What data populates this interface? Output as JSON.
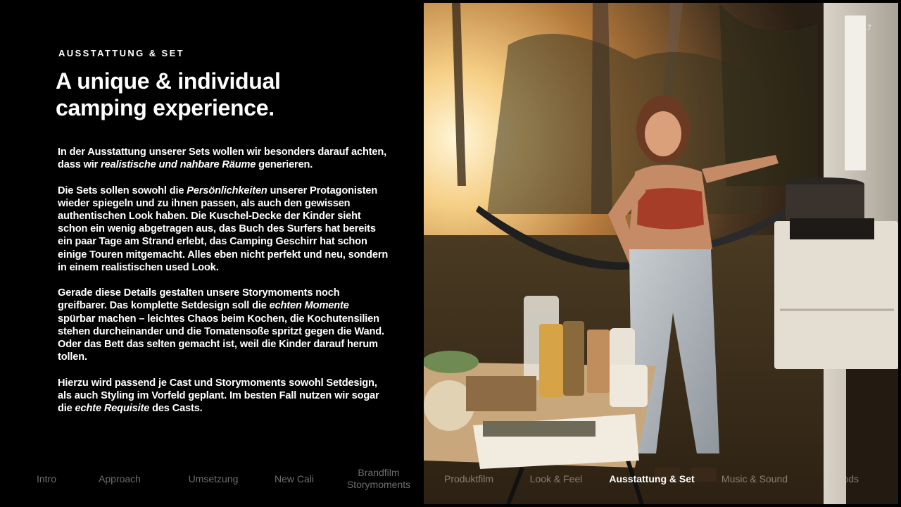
{
  "section": {
    "eyebrow": "AUSSTATTUNG & SET",
    "headline_line1": "A unique & individual",
    "headline_line2": "camping experience."
  },
  "body": {
    "p1": [
      "In der Ausstattung unserer Sets wollen wir besonders darauf achten, dass wir ",
      "realistische und nahbare Räume",
      " generieren."
    ],
    "p2": [
      "Die Sets sollen sowohl die ",
      "Persönlichkeiten",
      " unserer Protagonisten wieder spiegeln und zu ihnen passen, als auch den gewissen authentischen Look haben. Die Kuschel-Decke der Kinder sieht schon ein wenig abgetragen aus, das Buch des Surfers hat bereits ein paar Tage am Strand erlebt, das Camping Geschirr hat schon einige Touren mitgemacht. Alles eben nicht perfekt und neu, sondern in einem realistischen used Look."
    ],
    "p3": [
      "Gerade diese Details gestalten unsere Storymoments noch greifbarer. Das komplette Setdesign soll die ",
      "echten Momente",
      " spürbar machen – leichtes Chaos beim Kochen, die Kochutensilien stehen durcheinander und die Tomatensoße spritzt gegen die Wand. Oder das Bett das selten gemacht ist, weil die Kinder darauf herum tollen."
    ],
    "p4": [
      "Hierzu wird passend je Cast und Storymoments sowohl Setdesign, als auch Styling im Vorfeld geplant. Im besten Fall nutzen wir sogar die ",
      "echte Requisite",
      " des Casts."
    ]
  },
  "page_number": "17",
  "nav": {
    "items": [
      {
        "label": "Intro"
      },
      {
        "label": "Approach"
      },
      {
        "label": "Umsetzung"
      },
      {
        "label": "New Cali"
      },
      {
        "label": "Brandfilm Storymoments"
      },
      {
        "label": "Produktfilm"
      },
      {
        "label": "Look & Feel"
      },
      {
        "label": "Ausstattung & Set"
      },
      {
        "label": "Music & Sound"
      },
      {
        "label": "Moods"
      }
    ],
    "active": "Ausstattung & Set"
  },
  "photo": {
    "subject": "woman-cooking-at-campervan-photo"
  },
  "colors": {
    "background": "#000000",
    "text": "#ffffff",
    "nav_inactive": "#6e6e6e",
    "nav_active": "#ffffff"
  }
}
